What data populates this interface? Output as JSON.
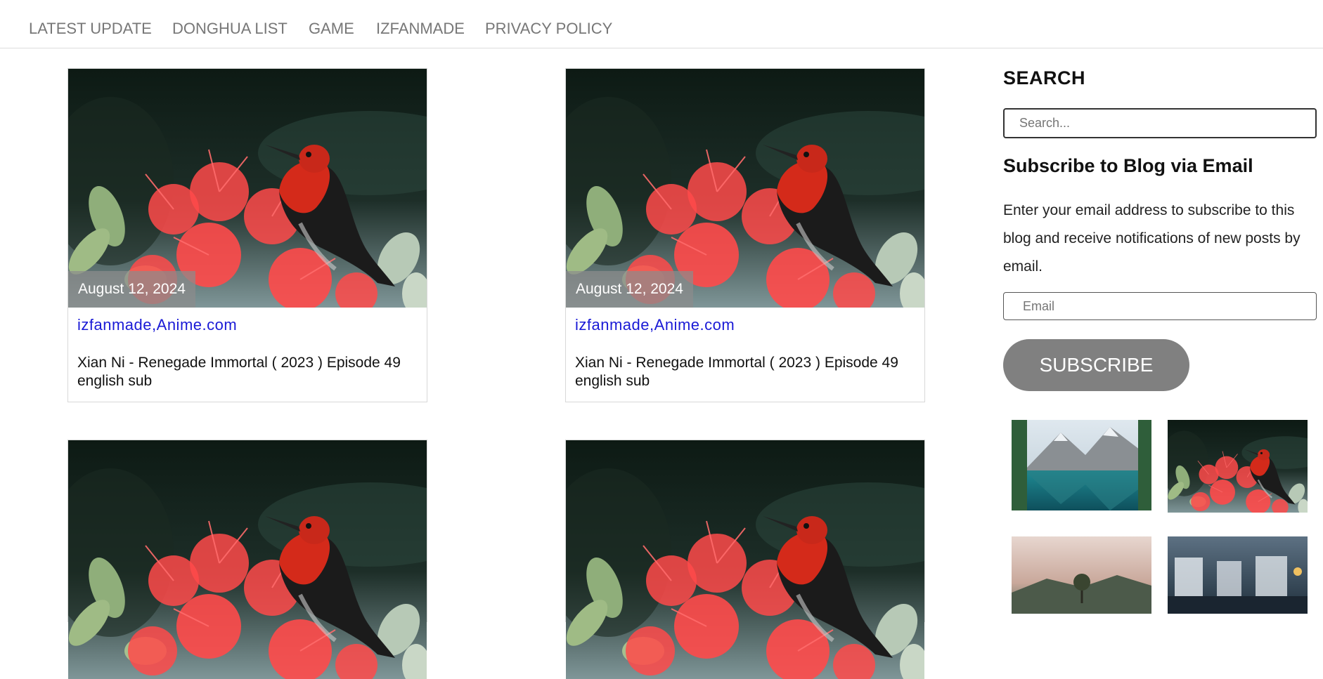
{
  "nav": {
    "items": [
      {
        "label": "LATEST UPDATE"
      },
      {
        "label": "DONGHUA LIST"
      },
      {
        "label": "GAME"
      },
      {
        "label": "IZFANMADE"
      },
      {
        "label": "PRIVACY POLICY"
      }
    ]
  },
  "posts": [
    {
      "date": "August 12, 2024",
      "cat1": "izfanmade",
      "sep": ",",
      "cat2": "Anime.com",
      "title": "Xian Ni - Renegade Immortal ( 2023 ) Episode 49 english sub"
    },
    {
      "date": "August 12, 2024",
      "cat1": "izfanmade",
      "sep": ",",
      "cat2": "Anime.com",
      "title": "Xian Ni - Renegade Immortal ( 2023 ) Episode 49 english sub"
    },
    {
      "date": "",
      "cat1": "",
      "sep": "",
      "cat2": "",
      "title": ""
    },
    {
      "date": "",
      "cat1": "",
      "sep": "",
      "cat2": "",
      "title": ""
    }
  ],
  "sidebar": {
    "search_title": "SEARCH",
    "search_placeholder": "Search...",
    "subscribe_title": "Subscribe to Blog via Email",
    "subscribe_text": "Enter your email address to subscribe to this blog and receive notifications of new posts by email.",
    "email_placeholder": "Email",
    "subscribe_button": "SUBSCRIBE"
  },
  "colors": {
    "link": "#1a1ad6",
    "button": "#808080",
    "nav_text": "#777777"
  }
}
